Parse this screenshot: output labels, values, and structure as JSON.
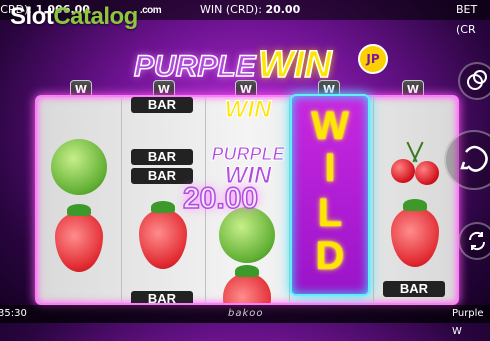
{
  "topbar": {
    "credit_label": "(CRD):",
    "credit_value": "1,006.00",
    "win_label": "WIN (CRD):",
    "win_value": "20.00",
    "bet_label": "BET (CR"
  },
  "watermark": {
    "part1": "Slot",
    "part2": "Catalog",
    "suffix": ".com"
  },
  "logo": {
    "word1": "PURPLE",
    "word2": "WIN",
    "badge": "JP"
  },
  "payline_markers": [
    "W",
    "W",
    "W",
    "W",
    "W"
  ],
  "reels": {
    "reel1": [
      "melon",
      "strawberry"
    ],
    "reel2": [
      "BAR",
      "BAR",
      "BAR",
      "strawberry",
      "BAR"
    ],
    "reel3": [
      "WIN",
      "PURPLE",
      "WIN",
      "melon",
      "strawberry"
    ],
    "reel4": [
      "W",
      "I",
      "L",
      "D"
    ],
    "reel5": [
      "cherry",
      "strawberry",
      "BAR"
    ]
  },
  "win_amount": "20.00",
  "controls": [
    "coins-icon",
    "spin-icon",
    "autoplay-icon"
  ],
  "bottombar": {
    "time": "35:30",
    "brand": "bakoo",
    "game": "Purple W"
  },
  "colors": {
    "accent": "#ff7cff",
    "wild_border": "#5ff0ff",
    "gold": "#ffe600",
    "purple": "#b34be0"
  }
}
